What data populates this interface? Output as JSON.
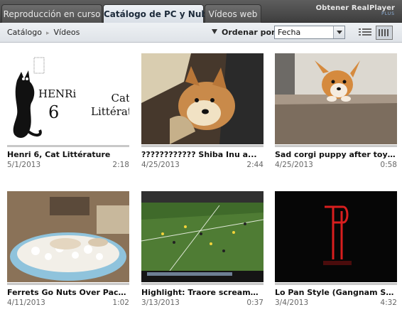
{
  "tabs": [
    {
      "label": "Reproducción en curso",
      "active": false
    },
    {
      "label": "Catálogo de PC y Nube",
      "active": true
    },
    {
      "label": "Vídeos web",
      "active": false
    }
  ],
  "brand": {
    "line1": "Obtener RealPlayer",
    "line2": "PLUS"
  },
  "toolbar": {
    "breadcrumb": [
      "Catálogo",
      "Vídeos"
    ],
    "sort_label": "Ordenar por",
    "sort_value": "Fecha",
    "view_modes": [
      "list-view-icon",
      "grid-view-icon"
    ]
  },
  "videos": [
    {
      "title": "Henri 6, Cat Littérature",
      "date": "5/1/2013",
      "duration": "2:18",
      "thumb_text": {
        "henri": "HENRi",
        "number": "6",
        "cat": "Cat",
        "litterature": "Littérature"
      }
    },
    {
      "title": "???????????? Shiba Inu a...",
      "date": "4/25/2013",
      "duration": "2:44"
    },
    {
      "title": "Sad corgi puppy after toy fa...",
      "date": "4/25/2013",
      "duration": "0:58"
    },
    {
      "title": "Ferrets Go Nuts Over Packi...",
      "date": "4/11/2013",
      "duration": "1:02"
    },
    {
      "title": "Highlight: Traore screamer -...",
      "date": "3/13/2013",
      "duration": "0:37"
    },
    {
      "title": "Lo Pan Style (Gangnam Styl...",
      "date": "3/4/2013",
      "duration": "4:32"
    }
  ],
  "colors": {
    "tabbar": "#4a4a4a",
    "active_tab": "#e3e8ee",
    "toolbar": "#e6e9ed"
  }
}
